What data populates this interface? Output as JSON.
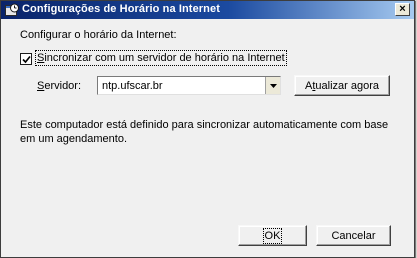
{
  "window": {
    "title": "Configurações de Horário na Internet",
    "close_glyph": "×"
  },
  "caption": "Configurar o horário da Internet:",
  "sync": {
    "checked": true,
    "label_mnemonic": "S",
    "label_rest": "incronizar com um servidor de horário na Internet"
  },
  "server": {
    "label_mnemonic": "S",
    "label_rest": "ervidor:",
    "value": "ntp.ufscar.br"
  },
  "update_button": {
    "label_pre": "A",
    "label_mnemonic": "t",
    "label_rest": "ualizar agora"
  },
  "description": {
    "line1": "Este computador está definido para sincronizar automaticamente com base",
    "line2": "em um agendamento."
  },
  "buttons": {
    "ok": "OK",
    "cancel": "Cancelar"
  }
}
